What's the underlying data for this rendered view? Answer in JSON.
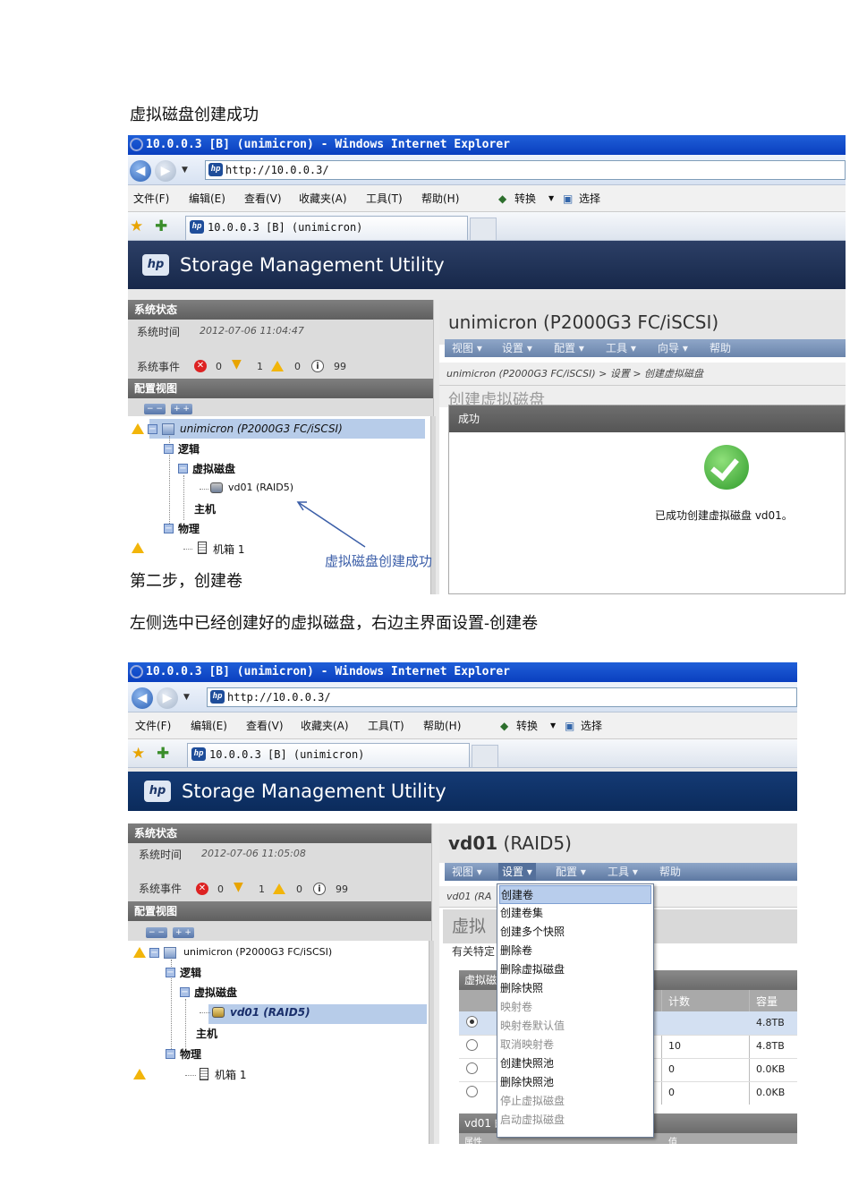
{
  "doc": {
    "heading1": "虚拟磁盘创建成功",
    "step2": "第二步，创建卷",
    "instruction": "左侧选中已经创建好的虚拟磁盘，右边主界面设置-创建卷"
  },
  "browser": {
    "window_title": "10.0.0.3 [B] (unimicron) - Windows Internet Explorer",
    "url": "http://10.0.0.3/",
    "menu": [
      "文件(F)",
      "编辑(E)",
      "查看(V)",
      "收藏夹(A)",
      "工具(T)",
      "帮助(H)"
    ],
    "convert_label": "转换",
    "select_label": "选择",
    "tab_title": "10.0.0.3 [B] (unimicron)"
  },
  "app": {
    "title": "Storage Management Utility",
    "status_header": "系统状态",
    "time_label": "系统时间",
    "events_label": "系统事件",
    "config_header": "配置视图",
    "collapse_label": "− −",
    "expand_label": "+ +",
    "tree": {
      "root": "unimicron (P2000G3 FC/iSCSI)",
      "logical": "逻辑",
      "vdisks": "虚拟磁盘",
      "vdisk": "vd01 (RAID5)",
      "host": "主机",
      "physical": "物理",
      "enclosure": "机箱 1"
    },
    "events": {
      "critical": "0",
      "error": "1",
      "warning": "0",
      "info": "99"
    },
    "topmenu": [
      "视图 ▾",
      "设置 ▾",
      "配置 ▾",
      "工具 ▾",
      "向导 ▾",
      "帮助"
    ]
  },
  "shot1": {
    "system_time": "2012-07-06 11:04:47",
    "right_title": "unimicron (P2000G3 FC/iSCSI)",
    "breadcrumb": "unimicron (P2000G3 FC/iSCSI) > 设置 > 创建虚拟磁盘",
    "page_heading": "创建虚拟磁盘",
    "dialog_title": "成功",
    "success_msg": "已成功创建虚拟磁盘 vd01。",
    "annotation": "虚拟磁盘创建成功"
  },
  "shot2": {
    "system_time": "2012-07-06 11:05:08",
    "right_title_bold": "vd01",
    "right_title_rest": " (RAID5)",
    "breadcrumb": "vd01 (RA",
    "page_heading": "虚拟",
    "sub_text": "有关特定",
    "table_header": "虚拟磁",
    "bottom_header": "vd01 的",
    "prop_label": "属性",
    "value_label": "值",
    "col_count": "计数",
    "col_capacity": "容量",
    "rows": [
      {
        "count": "",
        "capacity": "4.8TB",
        "selected": true
      },
      {
        "count": "10",
        "capacity": "4.8TB",
        "selected": false
      },
      {
        "count": "0",
        "capacity": "0.0KB",
        "selected": false
      },
      {
        "count": "0",
        "capacity": "0.0KB",
        "selected": false
      }
    ],
    "dropdown": [
      {
        "label": "创建卷",
        "state": "highlight"
      },
      {
        "label": "创建卷集",
        "state": "normal"
      },
      {
        "label": "创建多个快照",
        "state": "normal"
      },
      {
        "label": "删除卷",
        "state": "normal"
      },
      {
        "label": "删除虚拟磁盘",
        "state": "normal"
      },
      {
        "label": "删除快照",
        "state": "normal"
      },
      {
        "label": "映射卷",
        "state": "disabled"
      },
      {
        "label": "映射卷默认值",
        "state": "disabled"
      },
      {
        "label": "取消映射卷",
        "state": "disabled"
      },
      {
        "label": "创建快照池",
        "state": "normal"
      },
      {
        "label": "删除快照池",
        "state": "normal"
      },
      {
        "label": "停止虚拟磁盘",
        "state": "disabled"
      },
      {
        "label": "启动虚拟磁盘",
        "state": "disabled"
      }
    ]
  }
}
